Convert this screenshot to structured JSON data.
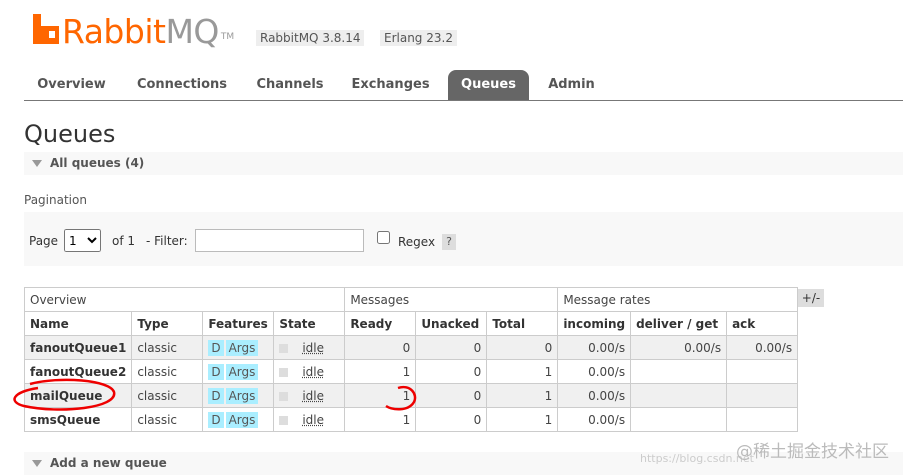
{
  "header": {
    "logo_main": "Rabbit",
    "logo_accent": "MQ",
    "logo_tm": "TM",
    "version": "RabbitMQ 3.8.14",
    "erlang": "Erlang 23.2"
  },
  "nav": {
    "tabs": [
      "Overview",
      "Connections",
      "Channels",
      "Exchanges",
      "Queues",
      "Admin"
    ],
    "active": "Queues"
  },
  "page": {
    "title": "Queues",
    "all_queues": "All queues (4)",
    "pagination_label": "Pagination",
    "page_label": "Page",
    "page_value": "1",
    "of_label": "of 1",
    "filter_label": "- Filter:",
    "filter_value": "",
    "regex_label": "Regex",
    "help": "?",
    "plus_minus": "+/-",
    "add_queue": "Add a new queue"
  },
  "table": {
    "groups": [
      "Overview",
      "Messages",
      "Message rates"
    ],
    "columns": [
      "Name",
      "Type",
      "Features",
      "State",
      "Ready",
      "Unacked",
      "Total",
      "incoming",
      "deliver / get",
      "ack"
    ],
    "rows": [
      {
        "name": "fanoutQueue1",
        "type": "classic",
        "f1": "D",
        "f2": "Args",
        "state": "idle",
        "ready": "0",
        "unacked": "0",
        "total": "0",
        "incoming": "0.00/s",
        "deliver": "0.00/s",
        "ack": "0.00/s"
      },
      {
        "name": "fanoutQueue2",
        "type": "classic",
        "f1": "D",
        "f2": "Args",
        "state": "idle",
        "ready": "1",
        "unacked": "0",
        "total": "1",
        "incoming": "0.00/s",
        "deliver": "",
        "ack": ""
      },
      {
        "name": "mailQueue",
        "type": "classic",
        "f1": "D",
        "f2": "Args",
        "state": "idle",
        "ready": "1",
        "unacked": "0",
        "total": "1",
        "incoming": "0.00/s",
        "deliver": "",
        "ack": ""
      },
      {
        "name": "smsQueue",
        "type": "classic",
        "f1": "D",
        "f2": "Args",
        "state": "idle",
        "ready": "1",
        "unacked": "0",
        "total": "1",
        "incoming": "0.00/s",
        "deliver": "",
        "ack": ""
      }
    ]
  },
  "watermark": "@稀土掘金技术社区",
  "watermark_faint": "https://blog.csdn.net",
  "colors": {
    "brand": "#ff6600",
    "pill": "#aaeeff",
    "annotation": "#ee0000"
  }
}
